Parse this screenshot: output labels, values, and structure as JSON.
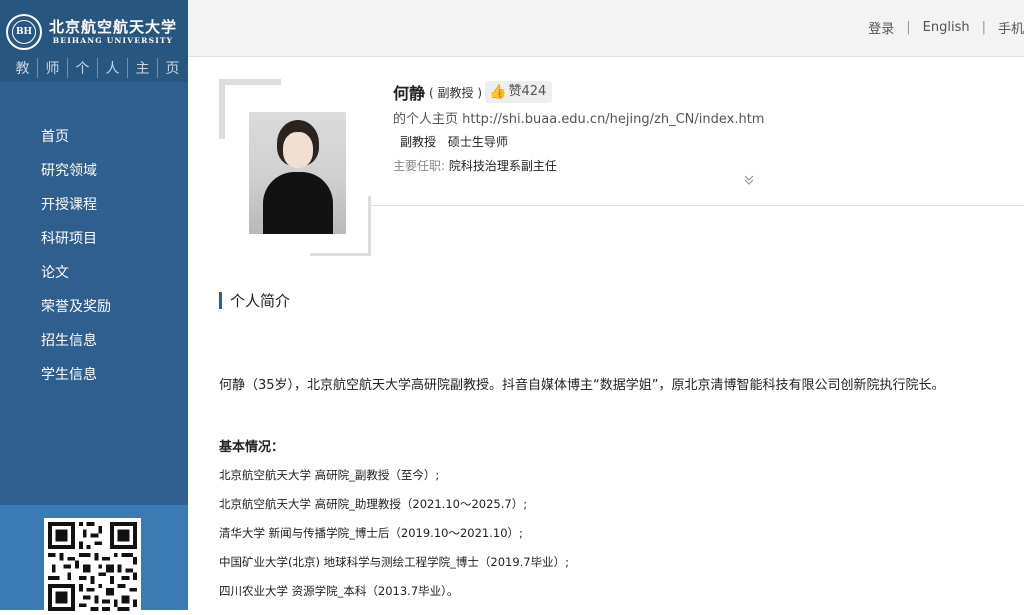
{
  "sidebar": {
    "logo_cn": "北京航空航天大学",
    "logo_en": "BEIHANG UNIVERSITY",
    "emblem_text": "BH",
    "tagline": [
      "教",
      "师",
      "个",
      "人",
      "主",
      "页"
    ],
    "nav": [
      "首页",
      "研究领域",
      "开授课程",
      "科研项目",
      "论文",
      "荣誉及奖励",
      "招生信息",
      "学生信息"
    ]
  },
  "topbar": {
    "login": "登录",
    "english": "English",
    "mobile": "手机"
  },
  "profile": {
    "name": "何静",
    "rank": "( 副教授 )",
    "like_label": "赞424",
    "homepage_label": "的个人主页",
    "homepage_url": "http://shi.buaa.edu.cn/hejing/zh_CN/index.htm",
    "titles": [
      "副教授",
      "硕士生导师"
    ],
    "duty_label": "主要任职:",
    "duty_value": "院科技治理系副主任",
    "expand_icon": "double-chevron-down"
  },
  "section": {
    "title": "个人简介",
    "intro": "何静（35岁），北京航空航天大学高研院副教授。抖音自媒体博主“数据学姐”，原北京清博智能科技有限公司创新院执行院长。",
    "basic_title": "基本情况：",
    "items": [
      "北京航空航天大学 高研院_副教授（至今）;",
      "北京航空航天大学 高研院_助理教授（2021.10～2025.7）;",
      "清华大学 新闻与传播学院_博士后（2019.10～2021.10）;",
      "中国矿业大学(北京) 地球科学与测绘工程学院_博士（2019.7毕业）;",
      "四川农业大学 资源学院_本科（2013.7毕业）。"
    ]
  },
  "colors": {
    "sidebar": "#2e5f8e",
    "sidebar_top": "#275680",
    "qr_bg": "#3a7ab5",
    "like_thumb": "#e0282e"
  }
}
